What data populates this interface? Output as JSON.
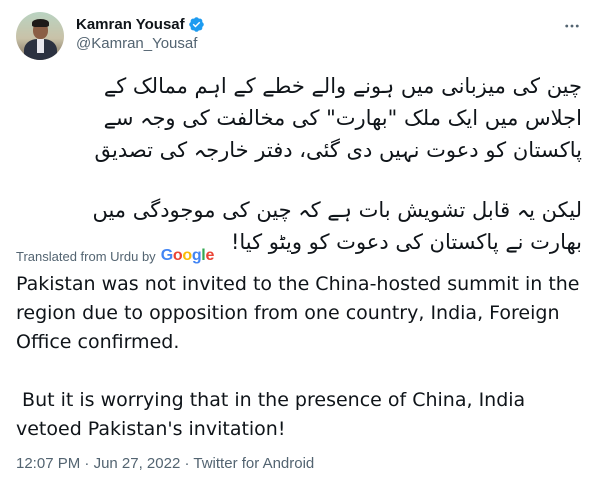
{
  "author": {
    "name": "Kamran Yousaf",
    "handle": "@Kamran_Yousaf",
    "verified": true
  },
  "tweet": {
    "urdu_lines": [
      "چین کی میزبانی میں ہونے والے خطے کے اہم ممالک کے",
      "اجلاس میں ایک ملک \"بھارت\" کی مخالفت کی وجہ سے",
      "پاکستان کو دعوت نہیں دی گئی، دفتر خارجہ کی تصدیق",
      "لیکن یہ قابل تشویش بات ہے کہ چین کی موجودگی میں",
      "بھارت نے پاکستان کی دعوت کو ویٹو کیا!"
    ],
    "translated_label": "Translated from Urdu by",
    "translator": "Google",
    "english_paragraph_1": "Pakistan was not invited to the China-hosted summit in the region due to opposition from one country, India, Foreign Office confirmed.",
    "english_paragraph_2": " But it is worrying that in the presence of China, India vetoed Pakistan's invitation!"
  },
  "meta": {
    "time": "12:07 PM",
    "separator": "·",
    "date": "Jun 27, 2022",
    "source": "Twitter for Android"
  },
  "icons": {
    "verified": "verified-badge-icon",
    "more": "more-options-icon"
  },
  "colors": {
    "verified_blue": "#1d9bf0",
    "secondary_text": "#536471",
    "primary_text": "#0f1419"
  }
}
